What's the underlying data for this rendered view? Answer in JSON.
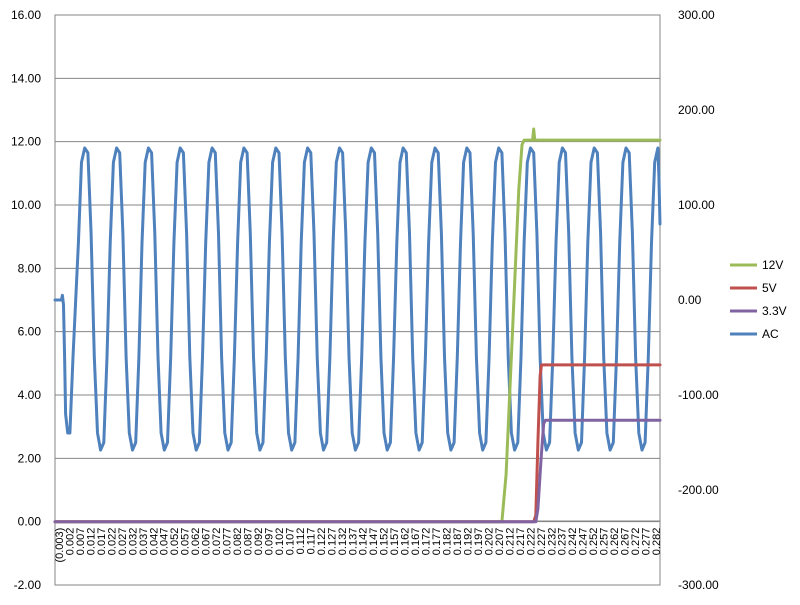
{
  "chart_data": {
    "type": "line",
    "title": "",
    "xlabel": "",
    "ylabel": "",
    "x_tick_labels": [
      "(0.003)",
      "0.002",
      "0.007",
      "0.012",
      "0.017",
      "0.022",
      "0.027",
      "0.032",
      "0.037",
      "0.042",
      "0.047",
      "0.052",
      "0.057",
      "0.062",
      "0.067",
      "0.072",
      "0.077",
      "0.082",
      "0.087",
      "0.092",
      "0.097",
      "0.102",
      "0.107",
      "0.112",
      "0.117",
      "0.122",
      "0.127",
      "0.132",
      "0.137",
      "0.142",
      "0.147",
      "0.152",
      "0.157",
      "0.162",
      "0.167",
      "0.172",
      "0.177",
      "0.182",
      "0.187",
      "0.192",
      "0.197",
      "0.202",
      "0.207",
      "0.212",
      "0.217",
      "0.222",
      "0.227",
      "0.232",
      "0.237",
      "0.242",
      "0.247",
      "0.252",
      "0.257",
      "0.262",
      "0.267",
      "0.272",
      "0.277",
      "0.282"
    ],
    "xlim": [
      -0.003,
      0.282
    ],
    "ylim_left": [
      -2,
      16
    ],
    "ylim_right": [
      -300,
      300
    ],
    "left_ticks": [
      "-2.00",
      "0.00",
      "2.00",
      "4.00",
      "6.00",
      "8.00",
      "10.00",
      "12.00",
      "14.00",
      "16.00"
    ],
    "right_ticks": [
      "-300.00",
      "-200.00",
      "-100.00",
      "0.00",
      "100.00",
      "200.00",
      "300.00"
    ],
    "grid": "horizontal",
    "legend_position": "right",
    "series": [
      {
        "name": "12V",
        "color": "#9BBB59",
        "axis": "left",
        "points": [
          [
            -0.003,
            0
          ],
          [
            0.2075,
            0
          ],
          [
            0.2095,
            1.5
          ],
          [
            0.2125,
            6
          ],
          [
            0.2155,
            10.5
          ],
          [
            0.217,
            11.9
          ],
          [
            0.218,
            12.05
          ],
          [
            0.222,
            12.05
          ],
          [
            0.2225,
            12.4
          ],
          [
            0.223,
            12.05
          ],
          [
            0.282,
            12.05
          ]
        ]
      },
      {
        "name": "5V",
        "color": "#C0504D",
        "axis": "left",
        "points": [
          [
            -0.003,
            0
          ],
          [
            0.2225,
            0
          ],
          [
            0.2235,
            0.2
          ],
          [
            0.2245,
            2.5
          ],
          [
            0.2255,
            4.6
          ],
          [
            0.2262,
            4.95
          ],
          [
            0.282,
            4.95
          ]
        ]
      },
      {
        "name": "3.3V",
        "color": "#8064A2",
        "axis": "left",
        "points": [
          [
            -0.003,
            0
          ],
          [
            0.2235,
            0
          ],
          [
            0.2245,
            0.4
          ],
          [
            0.226,
            2
          ],
          [
            0.2272,
            3.1
          ],
          [
            0.228,
            3.2
          ],
          [
            0.282,
            3.2
          ]
        ]
      },
      {
        "name": "AC",
        "color": "#4F81BD",
        "axis": "right",
        "points": [
          [
            -0.003,
            0
          ],
          [
            0.0,
            0
          ],
          [
            0.0005,
            5
          ],
          [
            0.001,
            -5
          ],
          [
            0.0015,
            -60
          ],
          [
            0.002,
            -120
          ],
          [
            0.003,
            -140
          ],
          [
            0.004,
            -140
          ],
          [
            0.0055,
            -60
          ],
          [
            0.008,
            60
          ],
          [
            0.0095,
            145
          ],
          [
            0.011,
            160
          ],
          [
            0.0125,
            155
          ],
          [
            0.014,
            70
          ],
          [
            0.0155,
            -60
          ],
          [
            0.017,
            -140
          ],
          [
            0.0185,
            -158
          ],
          [
            0.02,
            -150
          ],
          [
            0.0215,
            -60
          ],
          [
            0.023,
            60
          ],
          [
            0.0245,
            145
          ],
          [
            0.026,
            160
          ],
          [
            0.0275,
            155
          ],
          [
            0.029,
            70
          ],
          [
            0.0305,
            -60
          ],
          [
            0.032,
            -140
          ],
          [
            0.0335,
            -158
          ],
          [
            0.035,
            -150
          ],
          [
            0.0365,
            -60
          ],
          [
            0.038,
            60
          ],
          [
            0.0395,
            145
          ],
          [
            0.041,
            160
          ],
          [
            0.0425,
            155
          ],
          [
            0.044,
            70
          ],
          [
            0.0455,
            -60
          ],
          [
            0.047,
            -140
          ],
          [
            0.0485,
            -158
          ],
          [
            0.05,
            -150
          ],
          [
            0.0515,
            -60
          ],
          [
            0.053,
            60
          ],
          [
            0.0545,
            145
          ],
          [
            0.056,
            160
          ],
          [
            0.0575,
            155
          ],
          [
            0.059,
            70
          ],
          [
            0.0605,
            -60
          ],
          [
            0.062,
            -140
          ],
          [
            0.0635,
            -158
          ],
          [
            0.065,
            -150
          ],
          [
            0.0665,
            -60
          ],
          [
            0.068,
            60
          ],
          [
            0.0695,
            145
          ],
          [
            0.071,
            160
          ],
          [
            0.0725,
            155
          ],
          [
            0.074,
            70
          ],
          [
            0.0755,
            -60
          ],
          [
            0.077,
            -140
          ],
          [
            0.0785,
            -158
          ],
          [
            0.08,
            -150
          ],
          [
            0.0815,
            -60
          ],
          [
            0.083,
            60
          ],
          [
            0.0845,
            145
          ],
          [
            0.086,
            160
          ],
          [
            0.0875,
            155
          ],
          [
            0.089,
            70
          ],
          [
            0.0905,
            -60
          ],
          [
            0.092,
            -140
          ],
          [
            0.0935,
            -158
          ],
          [
            0.095,
            -150
          ],
          [
            0.0965,
            -60
          ],
          [
            0.098,
            60
          ],
          [
            0.0995,
            145
          ],
          [
            0.101,
            160
          ],
          [
            0.1025,
            155
          ],
          [
            0.104,
            70
          ],
          [
            0.1055,
            -60
          ],
          [
            0.107,
            -140
          ],
          [
            0.1085,
            -158
          ],
          [
            0.11,
            -150
          ],
          [
            0.1115,
            -60
          ],
          [
            0.113,
            60
          ],
          [
            0.1145,
            145
          ],
          [
            0.116,
            160
          ],
          [
            0.1175,
            155
          ],
          [
            0.119,
            70
          ],
          [
            0.1205,
            -60
          ],
          [
            0.122,
            -140
          ],
          [
            0.1235,
            -158
          ],
          [
            0.125,
            -150
          ],
          [
            0.1265,
            -60
          ],
          [
            0.128,
            60
          ],
          [
            0.1295,
            145
          ],
          [
            0.131,
            160
          ],
          [
            0.1325,
            155
          ],
          [
            0.134,
            70
          ],
          [
            0.1355,
            -60
          ],
          [
            0.137,
            -140
          ],
          [
            0.1385,
            -158
          ],
          [
            0.14,
            -150
          ],
          [
            0.1415,
            -60
          ],
          [
            0.143,
            60
          ],
          [
            0.1445,
            145
          ],
          [
            0.146,
            160
          ],
          [
            0.1475,
            155
          ],
          [
            0.149,
            70
          ],
          [
            0.1505,
            -60
          ],
          [
            0.152,
            -140
          ],
          [
            0.1535,
            -158
          ],
          [
            0.155,
            -150
          ],
          [
            0.1565,
            -60
          ],
          [
            0.158,
            60
          ],
          [
            0.1595,
            145
          ],
          [
            0.161,
            160
          ],
          [
            0.1625,
            155
          ],
          [
            0.164,
            70
          ],
          [
            0.1655,
            -60
          ],
          [
            0.167,
            -140
          ],
          [
            0.1685,
            -158
          ],
          [
            0.17,
            -150
          ],
          [
            0.1715,
            -60
          ],
          [
            0.173,
            60
          ],
          [
            0.1745,
            145
          ],
          [
            0.176,
            160
          ],
          [
            0.1775,
            155
          ],
          [
            0.179,
            70
          ],
          [
            0.1805,
            -60
          ],
          [
            0.182,
            -140
          ],
          [
            0.1835,
            -158
          ],
          [
            0.185,
            -150
          ],
          [
            0.1865,
            -60
          ],
          [
            0.188,
            60
          ],
          [
            0.1895,
            145
          ],
          [
            0.191,
            160
          ],
          [
            0.1925,
            155
          ],
          [
            0.194,
            70
          ],
          [
            0.1955,
            -60
          ],
          [
            0.197,
            -140
          ],
          [
            0.1985,
            -158
          ],
          [
            0.2,
            -150
          ],
          [
            0.2015,
            -60
          ],
          [
            0.203,
            60
          ],
          [
            0.2045,
            145
          ],
          [
            0.206,
            160
          ],
          [
            0.2075,
            155
          ],
          [
            0.209,
            70
          ],
          [
            0.2105,
            -60
          ],
          [
            0.212,
            -140
          ],
          [
            0.2135,
            -158
          ],
          [
            0.215,
            -150
          ],
          [
            0.2165,
            -60
          ],
          [
            0.218,
            60
          ],
          [
            0.2195,
            145
          ],
          [
            0.221,
            160
          ],
          [
            0.2225,
            155
          ],
          [
            0.224,
            70
          ],
          [
            0.2255,
            -60
          ],
          [
            0.227,
            -140
          ],
          [
            0.2285,
            -158
          ],
          [
            0.23,
            -150
          ],
          [
            0.2315,
            -60
          ],
          [
            0.233,
            60
          ],
          [
            0.2345,
            145
          ],
          [
            0.236,
            160
          ],
          [
            0.2375,
            155
          ],
          [
            0.239,
            70
          ],
          [
            0.2405,
            -60
          ],
          [
            0.242,
            -140
          ],
          [
            0.2435,
            -158
          ],
          [
            0.245,
            -150
          ],
          [
            0.2465,
            -60
          ],
          [
            0.248,
            60
          ],
          [
            0.2495,
            145
          ],
          [
            0.251,
            160
          ],
          [
            0.2525,
            155
          ],
          [
            0.254,
            70
          ],
          [
            0.2555,
            -60
          ],
          [
            0.257,
            -140
          ],
          [
            0.2585,
            -158
          ],
          [
            0.26,
            -150
          ],
          [
            0.2615,
            -60
          ],
          [
            0.263,
            60
          ],
          [
            0.2645,
            145
          ],
          [
            0.266,
            160
          ],
          [
            0.2675,
            155
          ],
          [
            0.269,
            70
          ],
          [
            0.2705,
            -60
          ],
          [
            0.272,
            -140
          ],
          [
            0.2735,
            -158
          ],
          [
            0.275,
            -150
          ],
          [
            0.2765,
            -60
          ],
          [
            0.278,
            60
          ],
          [
            0.2795,
            145
          ],
          [
            0.281,
            160
          ],
          [
            0.2815,
            130
          ],
          [
            0.282,
            80
          ]
        ]
      }
    ],
    "legend_order": [
      "12V",
      "5V",
      "3.3V",
      "AC"
    ]
  }
}
